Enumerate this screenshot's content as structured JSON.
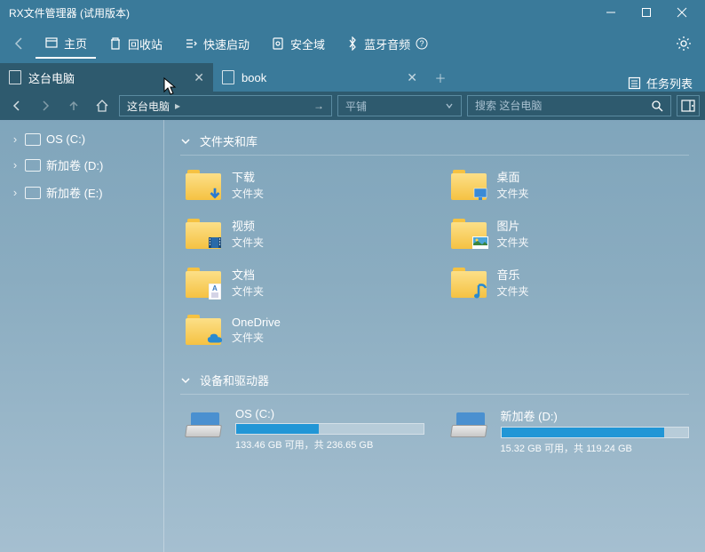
{
  "title": "RX文件管理器 (试用版本)",
  "toolbar": {
    "home": "主页",
    "recycle": "回收站",
    "quick": "快速启动",
    "secure": "安全域",
    "bluetooth": "蓝牙音频"
  },
  "tabs": [
    {
      "label": "这台电脑",
      "active": true
    },
    {
      "label": "book",
      "active": false
    }
  ],
  "tasklist": "任务列表",
  "address": "这台电脑",
  "viewmode": "平铺",
  "search_placeholder": "搜索 这台电脑",
  "tree": [
    {
      "label": "OS (C:)"
    },
    {
      "label": "新加卷 (D:)"
    },
    {
      "label": "新加卷 (E:)"
    }
  ],
  "sections": {
    "folders": "文件夹和库",
    "devices": "设备和驱动器"
  },
  "folders": [
    {
      "name": "下载",
      "type": "文件夹",
      "overlay": "download"
    },
    {
      "name": "桌面",
      "type": "文件夹",
      "overlay": "desktop"
    },
    {
      "name": "视频",
      "type": "文件夹",
      "overlay": "video"
    },
    {
      "name": "图片",
      "type": "文件夹",
      "overlay": "picture"
    },
    {
      "name": "文档",
      "type": "文件夹",
      "overlay": "doc"
    },
    {
      "name": "音乐",
      "type": "文件夹",
      "overlay": "music"
    },
    {
      "name": "OneDrive",
      "type": "文件夹",
      "overlay": "cloud"
    }
  ],
  "drives": [
    {
      "name": "OS (C:)",
      "stat": "133.46 GB 可用，共 236.65 GB",
      "pct": 44
    },
    {
      "name": "新加卷 (D:)",
      "stat": "15.32 GB 可用，共 119.24 GB",
      "pct": 87
    }
  ]
}
